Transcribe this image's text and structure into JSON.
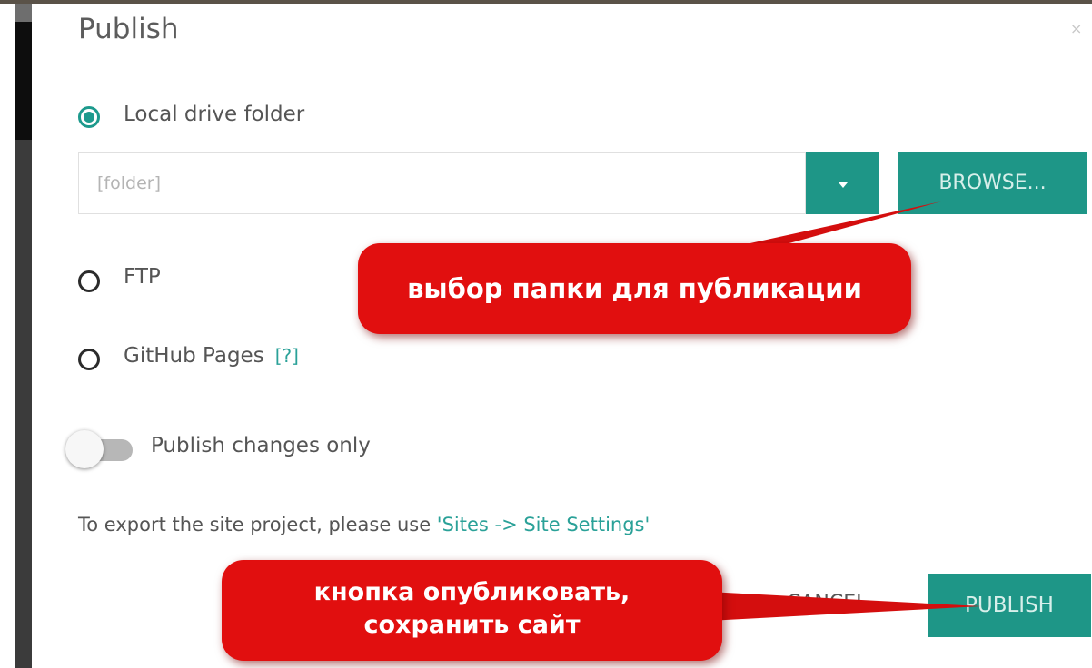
{
  "dialog": {
    "title": "Publish",
    "close_glyph": "×"
  },
  "options": {
    "local": {
      "label": "Local drive folder",
      "selected": true
    },
    "ftp": {
      "label": "FTP",
      "selected": false
    },
    "github": {
      "label": "GitHub Pages",
      "help": "[?]",
      "selected": false
    }
  },
  "folder": {
    "placeholder": "[folder]",
    "value": ""
  },
  "browse_label": "BROWSE...",
  "toggle": {
    "label": "Publish changes only",
    "on": false
  },
  "export_note": {
    "text": "To export the site project, please use ",
    "link": "'Sites -> Site Settings'"
  },
  "buttons": {
    "cancel": "CANCEL",
    "publish": "PUBLISH"
  },
  "callouts": {
    "folder_choice": "выбор папки для публикации",
    "publish_line1": "кнопка опубликовать,",
    "publish_line2": "сохранить сайт"
  },
  "colors": {
    "accent": "#1e9687",
    "link": "#2aa198",
    "callout": "#e10f0f"
  },
  "icons": {
    "dropdown": "caret-down-icon",
    "close": "close-icon"
  }
}
